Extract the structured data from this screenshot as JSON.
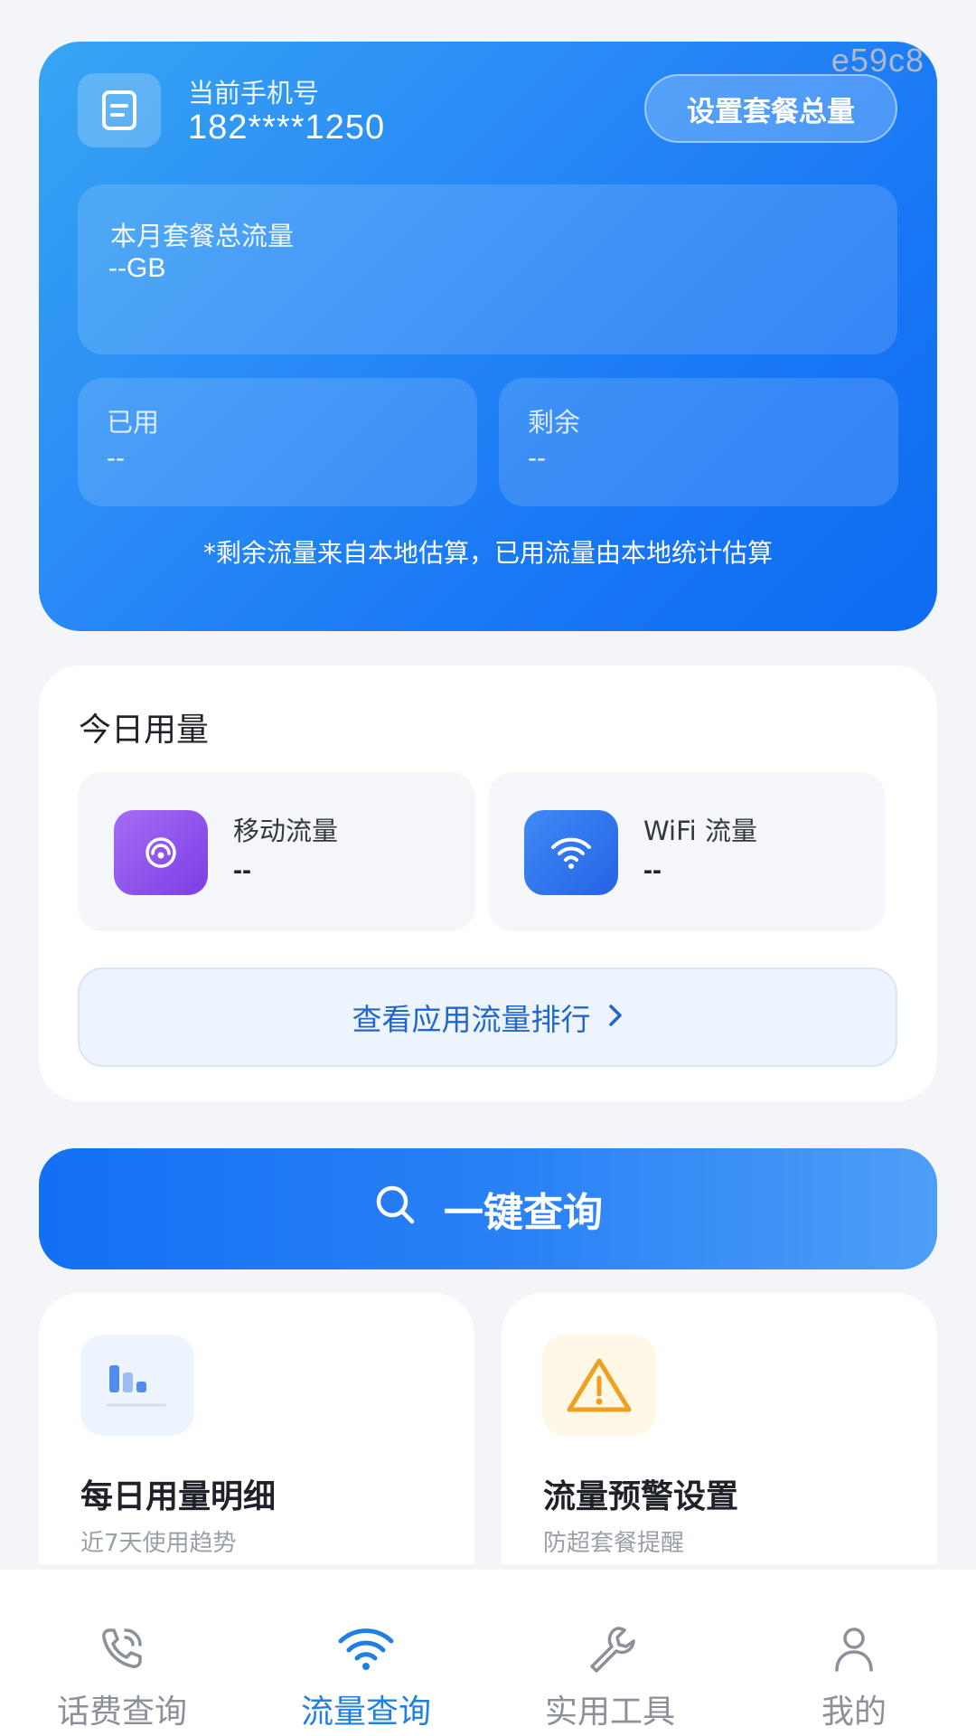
{
  "watermark": "e59c8",
  "hero": {
    "phone_label": "当前手机号",
    "phone_number": "182****1250",
    "set_plan_button": "设置套餐总量",
    "total_label": "本月套餐总流量",
    "total_value": "--GB",
    "used_label": "已用",
    "used_value": "--",
    "remaining_label": "剩余",
    "remaining_value": "--",
    "note": "*剩余流量来自本地估算，已用流量由本地统计估算"
  },
  "today": {
    "title": "今日用量",
    "mobile_label": "移动流量",
    "mobile_value": "--",
    "wifi_label": "WiFi 流量",
    "wifi_value": "--",
    "rank_button": "查看应用流量排行"
  },
  "query_button": "一键查询",
  "features": {
    "daily_title": "每日用量明细",
    "daily_sub": "近7天使用趋势",
    "alert_title": "流量预警设置",
    "alert_sub": "防超套餐提醒"
  },
  "nav": {
    "items": [
      {
        "label": "话费查询",
        "icon": "phone-icon"
      },
      {
        "label": "流量查询",
        "icon": "wifi-icon",
        "active": true
      },
      {
        "label": "实用工具",
        "icon": "wrench-icon"
      },
      {
        "label": "我的",
        "icon": "user-icon"
      }
    ]
  },
  "colors": {
    "accent": "#1f7fe2",
    "hero_start": "#37a5f3",
    "hero_end": "#0e6cf2",
    "warning": "#f0a020"
  }
}
